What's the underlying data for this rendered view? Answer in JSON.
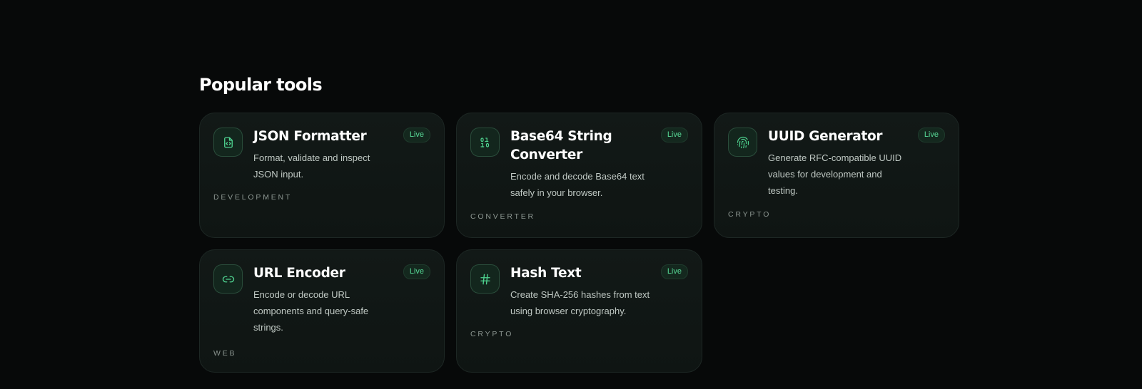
{
  "section": {
    "title": "Popular tools"
  },
  "tools": [
    {
      "title": "JSON Formatter",
      "badge": "Live",
      "description": "Format, validate and inspect JSON input.",
      "category": "DEVELOPMENT",
      "icon": "file-code-icon"
    },
    {
      "title": "Base64 String Converter",
      "badge": "Live",
      "description": "Encode and decode Base64 text safely in your browser.",
      "category": "CONVERTER",
      "icon": "binary-icon"
    },
    {
      "title": "UUID Generator",
      "badge": "Live",
      "description": "Generate RFC-compatible UUID values for development and testing.",
      "category": "CRYPTO",
      "icon": "fingerprint-icon"
    },
    {
      "title": "URL Encoder",
      "badge": "Live",
      "description": "Encode or decode URL components and query-safe strings.",
      "category": "WEB",
      "icon": "link-icon"
    },
    {
      "title": "Hash Text",
      "badge": "Live",
      "description": "Create SHA-256 hashes from text using browser cryptography.",
      "category": "CRYPTO",
      "icon": "hash-icon"
    }
  ],
  "colors": {
    "background": "#070909",
    "card": "#121917",
    "accent": "#57d996",
    "badge_bg": "#14281e"
  }
}
